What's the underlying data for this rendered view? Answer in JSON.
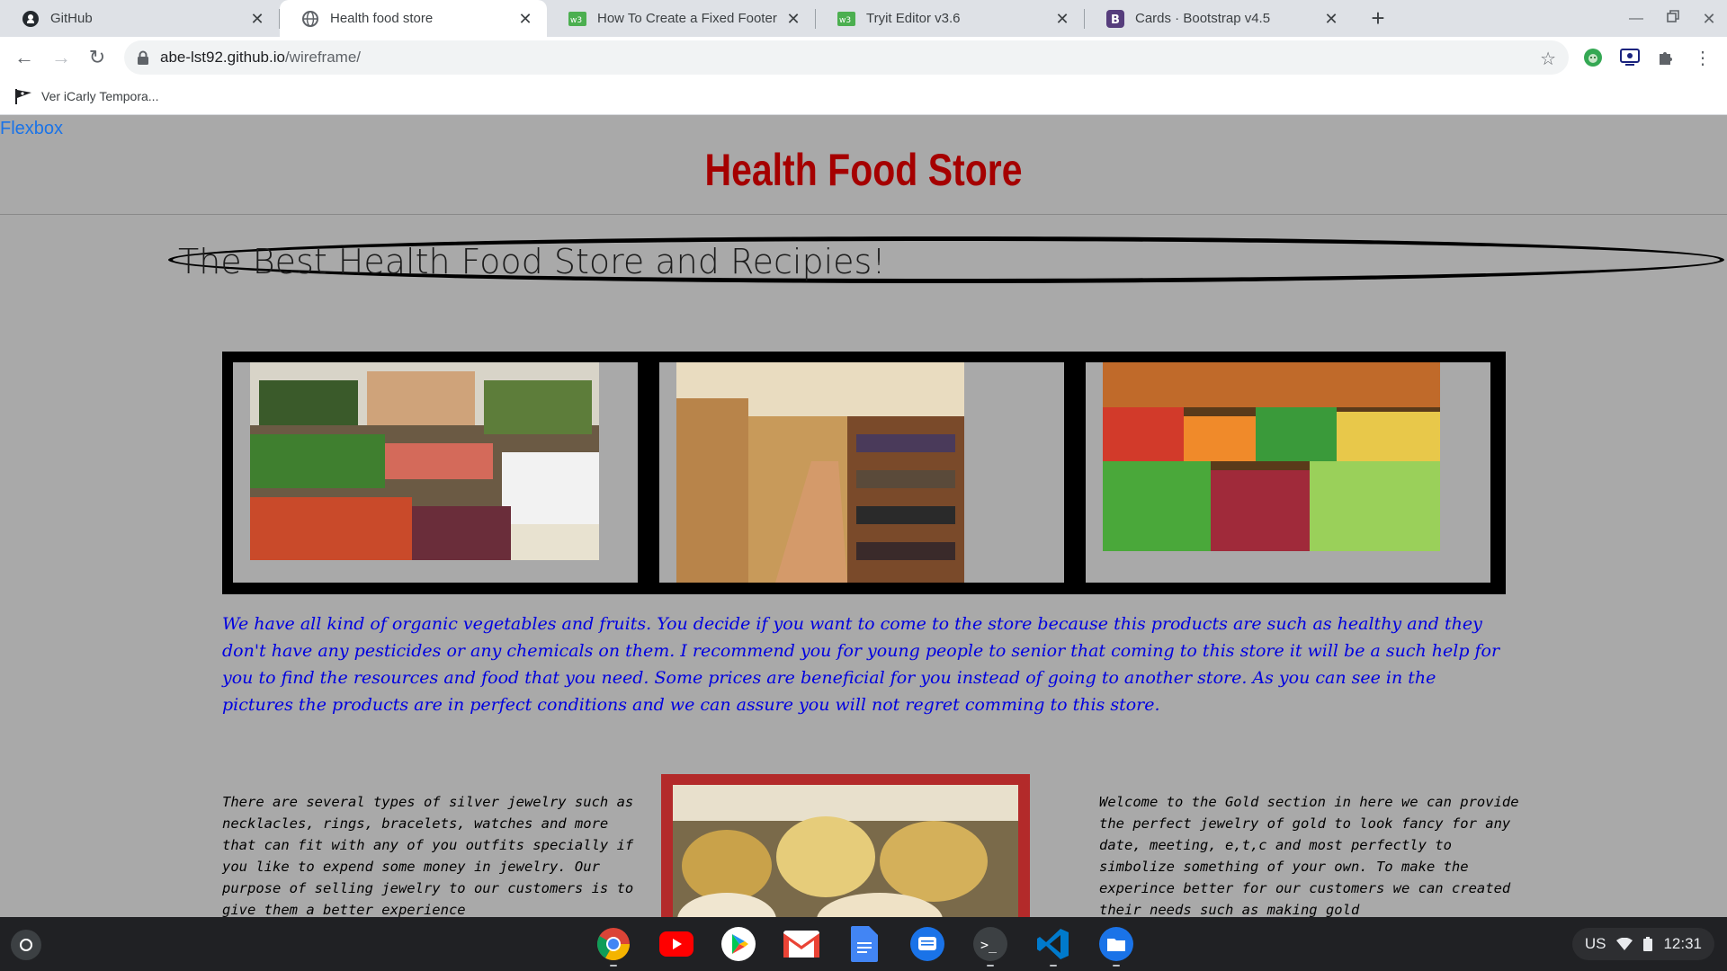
{
  "browser": {
    "tabs": [
      {
        "title": "GitHub",
        "icon": "github-icon"
      },
      {
        "title": "Health food store",
        "icon": "globe-icon",
        "active": true
      },
      {
        "title": "How To Create a Fixed Footer",
        "icon": "w3schools-icon"
      },
      {
        "title": "Tryit Editor v3.6",
        "icon": "w3schools-icon"
      },
      {
        "title": "Cards · Bootstrap v4.5",
        "icon": "bootstrap-icon"
      }
    ],
    "close_glyph": "✕",
    "new_tab_glyph": "+",
    "url_host": "abe-lst92.github.io",
    "url_path": "/wireframe/",
    "bookmark": "Ver iCarly Tempora..."
  },
  "page": {
    "nav_link": "Flexbox",
    "title": "Health Food Store",
    "tagline": "The Best Health Food Store and Recipies!",
    "gallery": [
      {
        "alt": "produce-aisle-photo"
      },
      {
        "alt": "store-shelves-photo"
      },
      {
        "alt": "vegetable-market-photo"
      }
    ],
    "intro": "We have all kind of organic vegetables and fruits. You decide if you want to come to the store because this products are such as healthy and they don't have any pesticides or any chemicals on them. I recommend you for young people to senior that coming to this store it will be a such help for you to find the resources and food that you need. Some prices are beneficial for you instead of going to another store. As you can see in the pictures the products are in perfect conditions and we can assure you will not regret comming to this store.",
    "silver_text": "There are several types of silver jewelry such as necklacles, rings, bracelets, watches and more that can fit with any of you outfits specially if you like to expend some money in jewelry. Our purpose of selling jewelry to our customers is to give them a better experience",
    "gold_text": "Welcome to the Gold section in here we can provide the perfect jewelry of gold to look fancy for any date, meeting, e,t,c and most perfectly to simbolize something of your own. To make the experince better for our customers we can created their needs such as making gold"
  },
  "shelf": {
    "apps": [
      "chrome-icon",
      "youtube-icon",
      "play-store-icon",
      "gmail-icon",
      "docs-icon",
      "messages-icon",
      "terminal-icon",
      "vscode-icon",
      "files-icon"
    ],
    "locale": "US",
    "time": "12:31"
  }
}
